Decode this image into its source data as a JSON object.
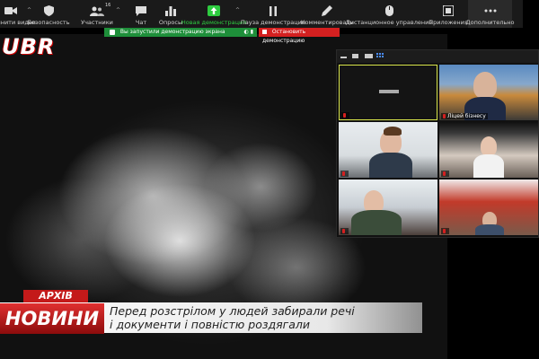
{
  "toolbar": {
    "items": [
      {
        "label": "Зупинити видео",
        "icon": "video-camera-icon"
      },
      {
        "label": "Безопасность",
        "icon": "shield-icon"
      },
      {
        "label": "Участники",
        "icon": "participants-icon",
        "count": "16"
      },
      {
        "label": "Чат",
        "icon": "chat-icon"
      },
      {
        "label": "Опросы",
        "icon": "polls-icon"
      },
      {
        "label": "Новая демонстрация",
        "icon": "share-screen-icon"
      },
      {
        "label": "Пауза демонстрации",
        "icon": "pause-icon"
      },
      {
        "label": "Комментировать",
        "icon": "pen-icon"
      },
      {
        "label": "Дистанционное управление",
        "icon": "mouse-icon"
      },
      {
        "label": "Приложения",
        "icon": "apps-icon"
      },
      {
        "label": "Дополнительно",
        "icon": "more-icon"
      }
    ]
  },
  "notice": {
    "text": "Вы запустили демонстрацию экрана"
  },
  "stop_share": {
    "label": "Остановить демонстрацию"
  },
  "shared_video": {
    "logo": "UBR",
    "tag": "АРХІВ",
    "section": "НОВИНИ",
    "headline_1": "Перед розстрілом у людей забирали речі",
    "headline_2": "і документи і повністю роздягали"
  },
  "gallery": {
    "tiles": [
      {
        "name": ""
      },
      {
        "name": "Ліцей бізнесу"
      },
      {
        "name": ""
      },
      {
        "name": ""
      },
      {
        "name": ""
      },
      {
        "name": ""
      }
    ]
  },
  "colors": {
    "notice_green": "#1e8f3a",
    "stop_red": "#d42020",
    "active_share": "#2ecc40",
    "speaker_border": "#d9e64a"
  }
}
